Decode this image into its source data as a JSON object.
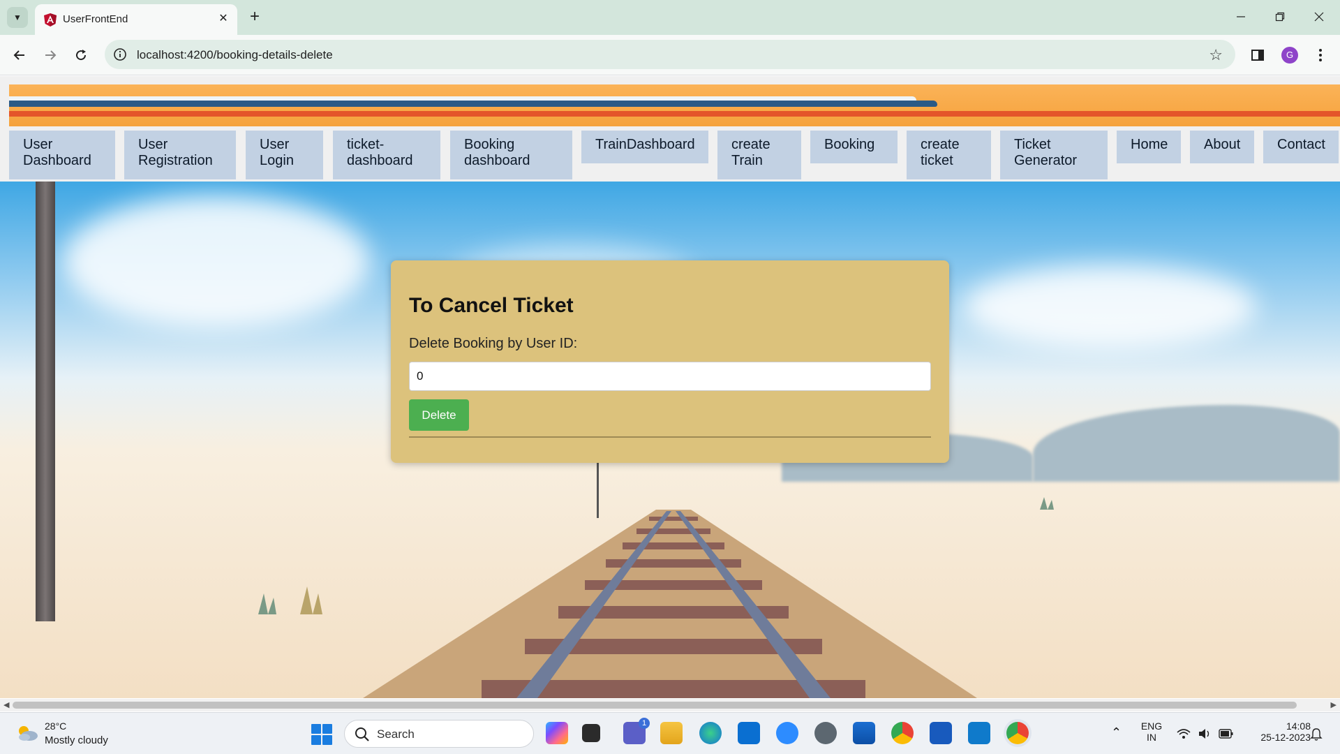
{
  "browser": {
    "tab_title": "UserFrontEnd",
    "url": "localhost:4200/booking-details-delete",
    "profile_initial": "G"
  },
  "nav": {
    "items": [
      {
        "label": "User\nDashboard"
      },
      {
        "label": "User\nRegistration"
      },
      {
        "label": "User\nLogin"
      },
      {
        "label": "ticket-\ndashboard"
      },
      {
        "label": "Booking\ndashboard"
      },
      {
        "label": "TrainDashboard"
      },
      {
        "label": "create\nTrain"
      },
      {
        "label": "Booking"
      },
      {
        "label": "create\nticket"
      },
      {
        "label": "Ticket\nGenerator"
      },
      {
        "label": "Home"
      },
      {
        "label": "About"
      },
      {
        "label": "Contact"
      }
    ]
  },
  "card": {
    "title": "To Cancel Ticket",
    "label": "Delete Booking by User ID:",
    "input_value": "0",
    "button_label": "Delete"
  },
  "taskbar": {
    "weather_temp": "28°C",
    "weather_desc": "Mostly cloudy",
    "search_placeholder": "Search",
    "lang_line1": "ENG",
    "lang_line2": "IN",
    "time": "14:08",
    "date": "25-12-2023",
    "teams_badge": "1"
  },
  "colors": {
    "card_bg": "#dcc27c",
    "button_bg": "#4caf50",
    "menu_bg": "#c2d1e3",
    "banner_orange": "#f5a23c"
  }
}
